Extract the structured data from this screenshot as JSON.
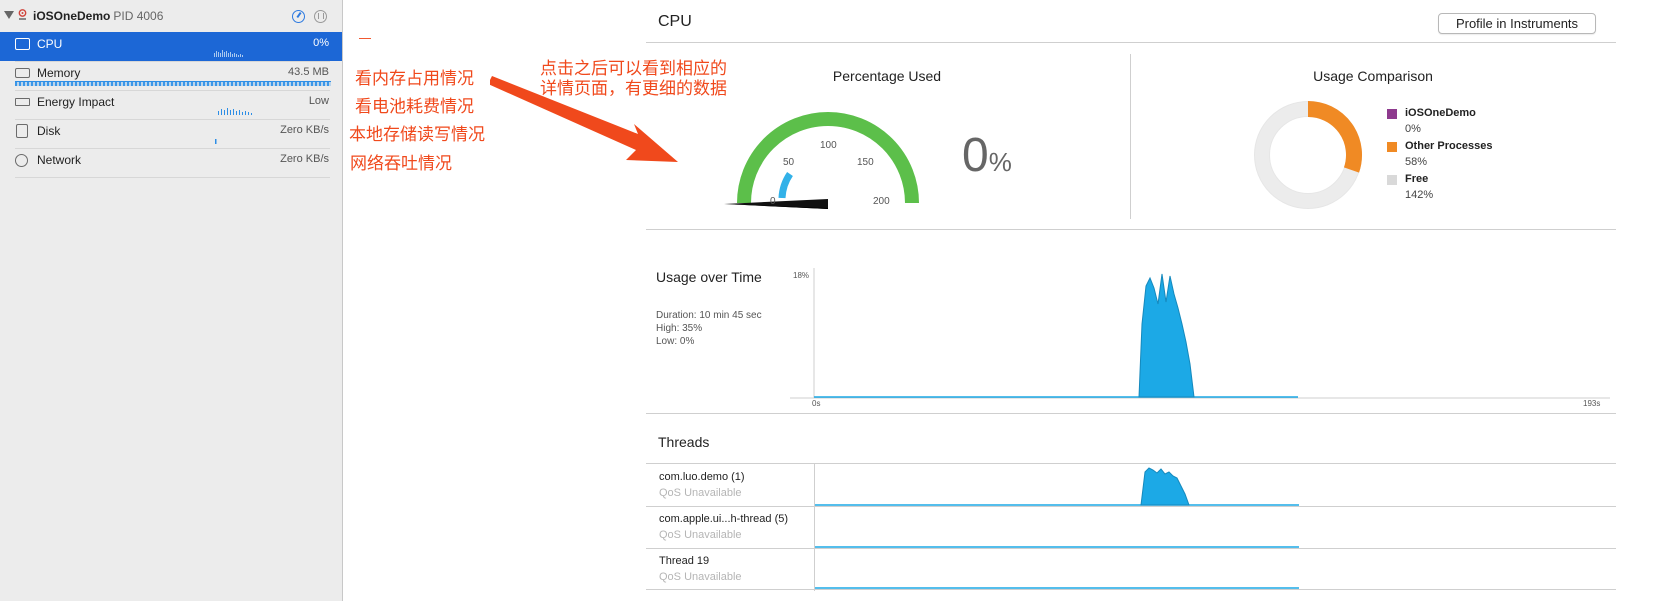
{
  "process": {
    "name": "iOSOneDemo",
    "pid": "PID 4006"
  },
  "gauges": [
    {
      "label": "CPU",
      "value": "0%",
      "icon": "cpu-icon",
      "selected": true
    },
    {
      "label": "Memory",
      "value": "43.5 MB",
      "icon": "memory-icon"
    },
    {
      "label": "Energy Impact",
      "value": "Low",
      "icon": "battery-icon"
    },
    {
      "label": "Disk",
      "value": "Zero KB/s",
      "icon": "disk-icon"
    },
    {
      "label": "Network",
      "value": "Zero KB/s",
      "icon": "globe-icon"
    }
  ],
  "annotations": {
    "memory": "看内存占用情况",
    "energy": "看电池耗费情况",
    "disk": "本地存储读写情况",
    "network": "网络吞吐情况",
    "detail_line1": "点击之后可以看到相应的",
    "detail_line2": "详情页面，有更细的数据"
  },
  "main": {
    "title": "CPU",
    "profile_button": "Profile in Instruments",
    "percentage_used": {
      "title": "Percentage Used",
      "value": "0",
      "unit": "%",
      "gauge_ticks": [
        "0",
        "50",
        "100",
        "150",
        "200"
      ]
    },
    "usage_comparison": {
      "title": "Usage Comparison",
      "legend": [
        {
          "name": "iOSOneDemo",
          "value": "0%",
          "color": "#8e3a8e"
        },
        {
          "name": "Other Processes",
          "value": "58%",
          "color": "#f08a24"
        },
        {
          "name": "Free",
          "value": "142%",
          "color": "#d9d9d9"
        }
      ]
    },
    "usage_over_time": {
      "title": "Usage over Time",
      "duration": "Duration: 10 min 45 sec",
      "high": "High: 35%",
      "low": "Low: 0%",
      "y_max_label": "18%",
      "x_start_label": "0s",
      "x_end_label": "193s"
    },
    "threads": {
      "title": "Threads",
      "items": [
        {
          "name": "com.luo.demo (1)",
          "qos": "QoS Unavailable"
        },
        {
          "name": "com.apple.ui...h-thread (5)",
          "qos": "QoS Unavailable"
        },
        {
          "name": "Thread 19",
          "qos": "QoS Unavailable"
        }
      ]
    }
  },
  "colors": {
    "selection": "#1c67d6",
    "accent": "#1ca9e6",
    "gauge_green": "#5cbf4a",
    "annotation": "#f0491c"
  }
}
